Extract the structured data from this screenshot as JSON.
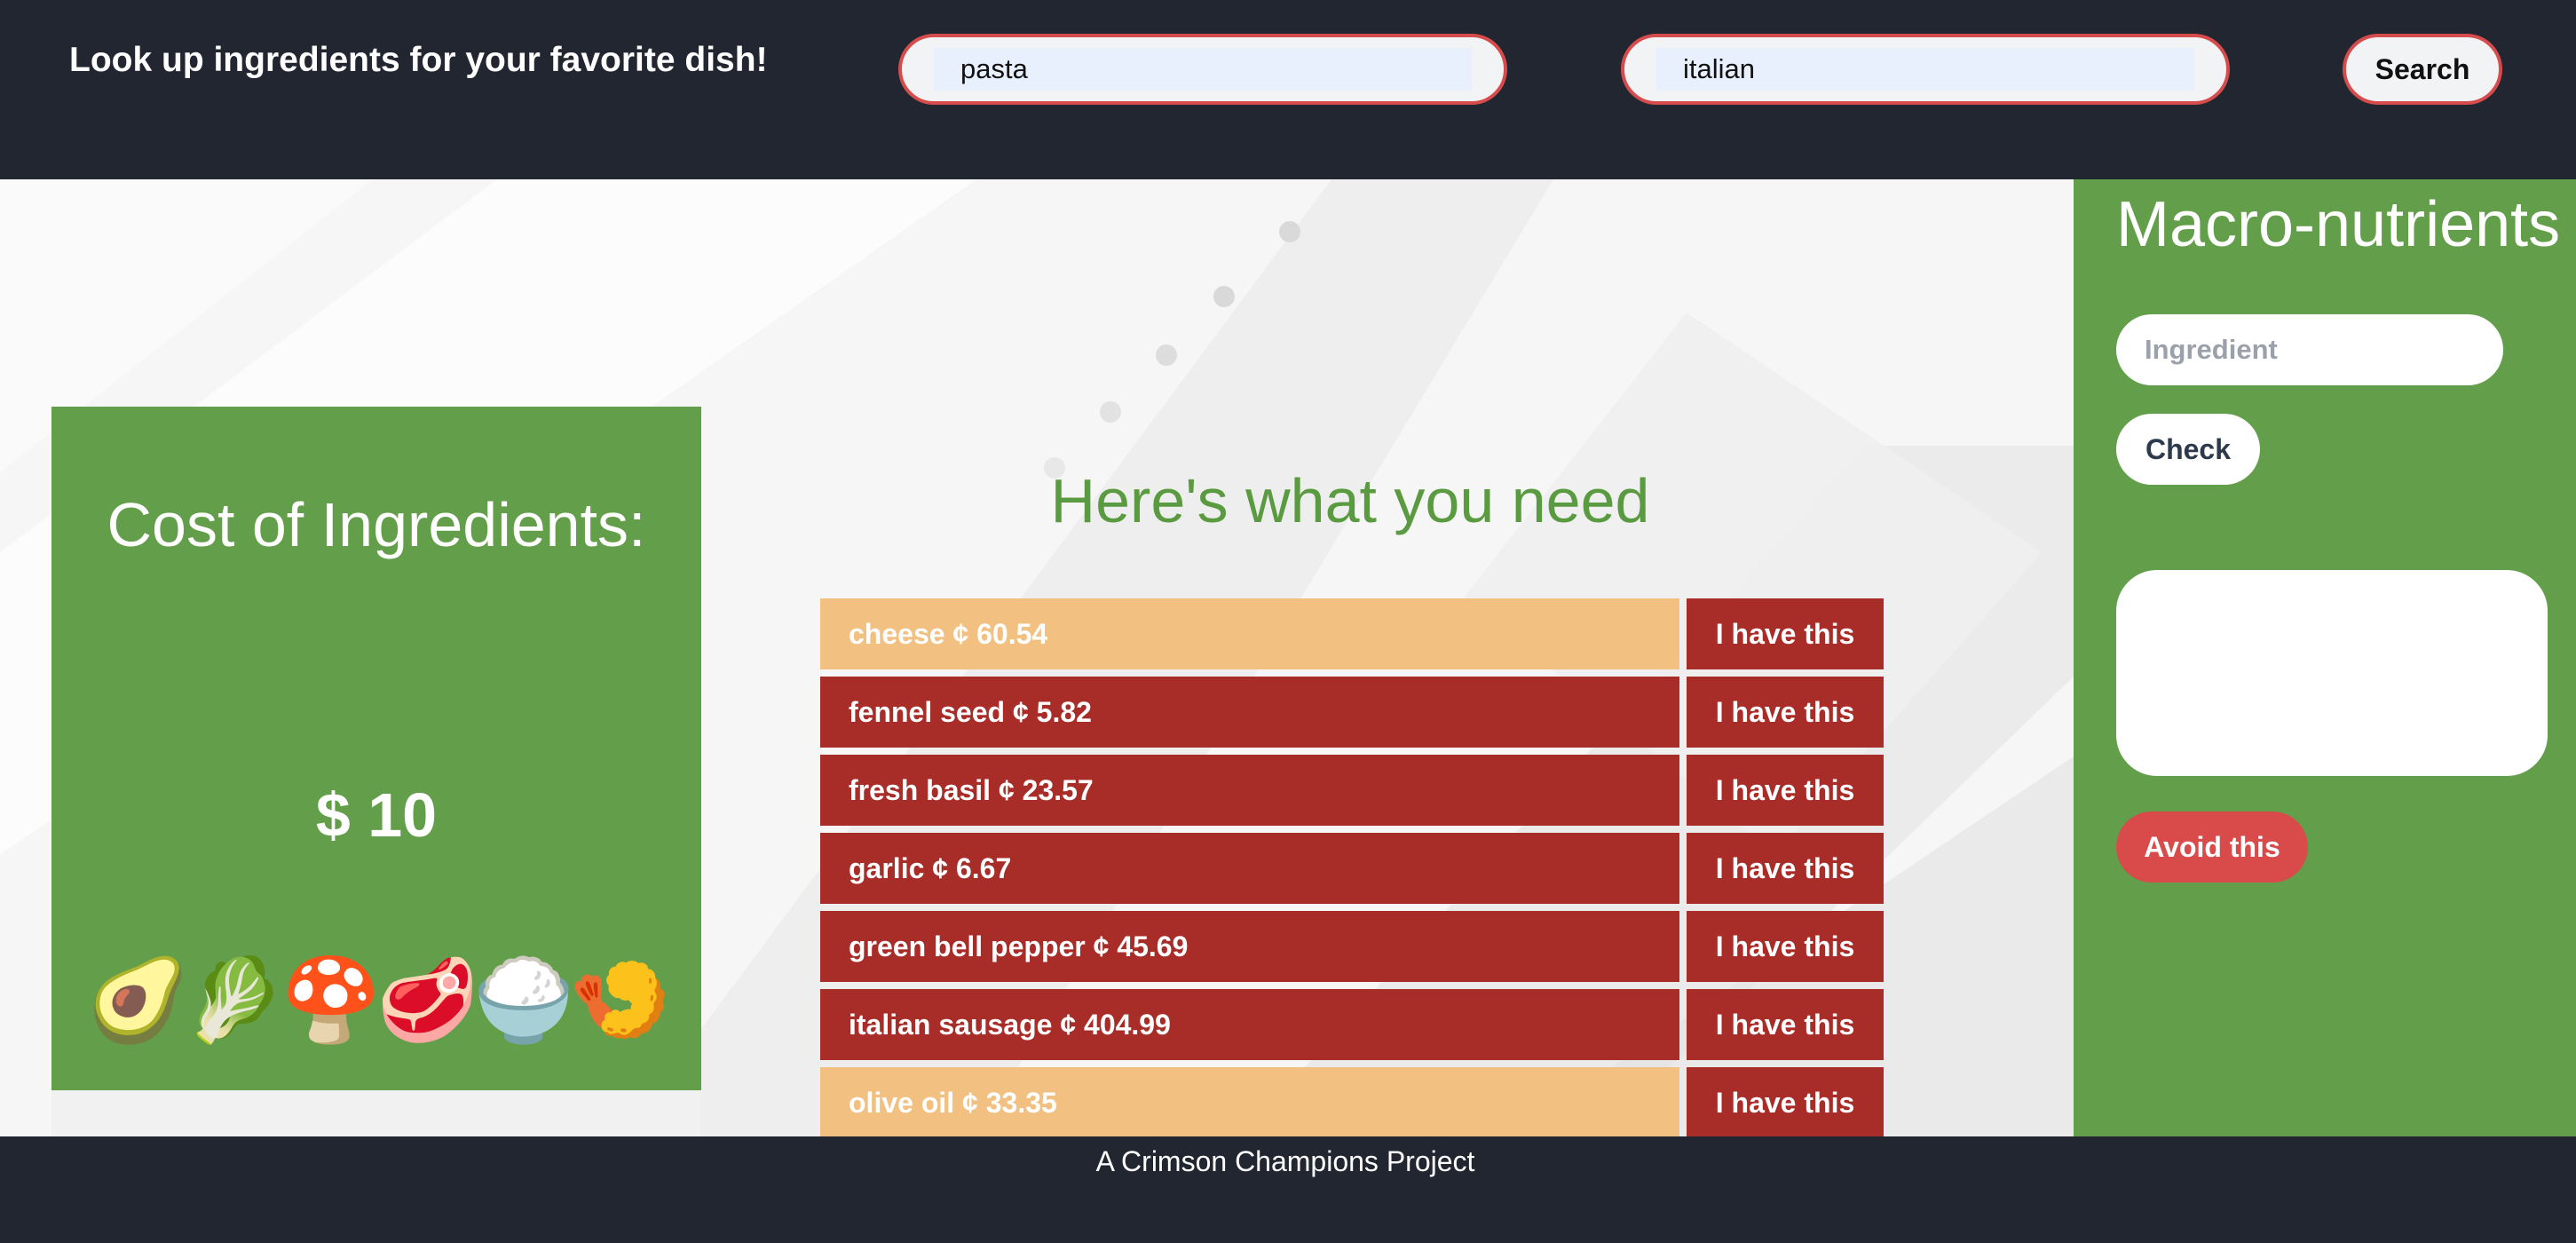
{
  "header": {
    "tagline": "Look up ingredients for your favorite dish!",
    "dish_value": "pasta",
    "cuisine_value": "italian",
    "search_label": "Search"
  },
  "cost_card": {
    "title": "Cost of Ingredients:",
    "amount": "$ 10",
    "emojis": "🥑🥬🍄🥩🍚🍤"
  },
  "main": {
    "title": "Here's what you need",
    "ingredients": [
      {
        "label": "cheese ¢ 60.54",
        "action": "I have this",
        "color": "#f2c080"
      },
      {
        "label": "fennel seed ¢ 5.82",
        "action": "I have this",
        "color": "#a82c27"
      },
      {
        "label": "fresh basil ¢ 23.57",
        "action": "I have this",
        "color": "#a82c27"
      },
      {
        "label": "garlic ¢ 6.67",
        "action": "I have this",
        "color": "#a82c27"
      },
      {
        "label": "green bell pepper ¢ 45.69",
        "action": "I have this",
        "color": "#a82c27"
      },
      {
        "label": "italian sausage ¢ 404.99",
        "action": "I have this",
        "color": "#a82c27"
      },
      {
        "label": "olive oil ¢ 33.35",
        "action": "I have this",
        "color": "#f2c080"
      }
    ]
  },
  "sidebar": {
    "title": "Macro-nutrients",
    "ingredient_placeholder": "Ingredient",
    "check_label": "Check",
    "avoid_label": "Avoid this"
  },
  "footer": {
    "text": "A Crimson Champions Project"
  },
  "colors": {
    "header_bg": "#222630",
    "accent_green": "#639e4a",
    "accent_red": "#a82c27",
    "accent_orange": "#f2c080",
    "search_border": "#d64c4c"
  }
}
